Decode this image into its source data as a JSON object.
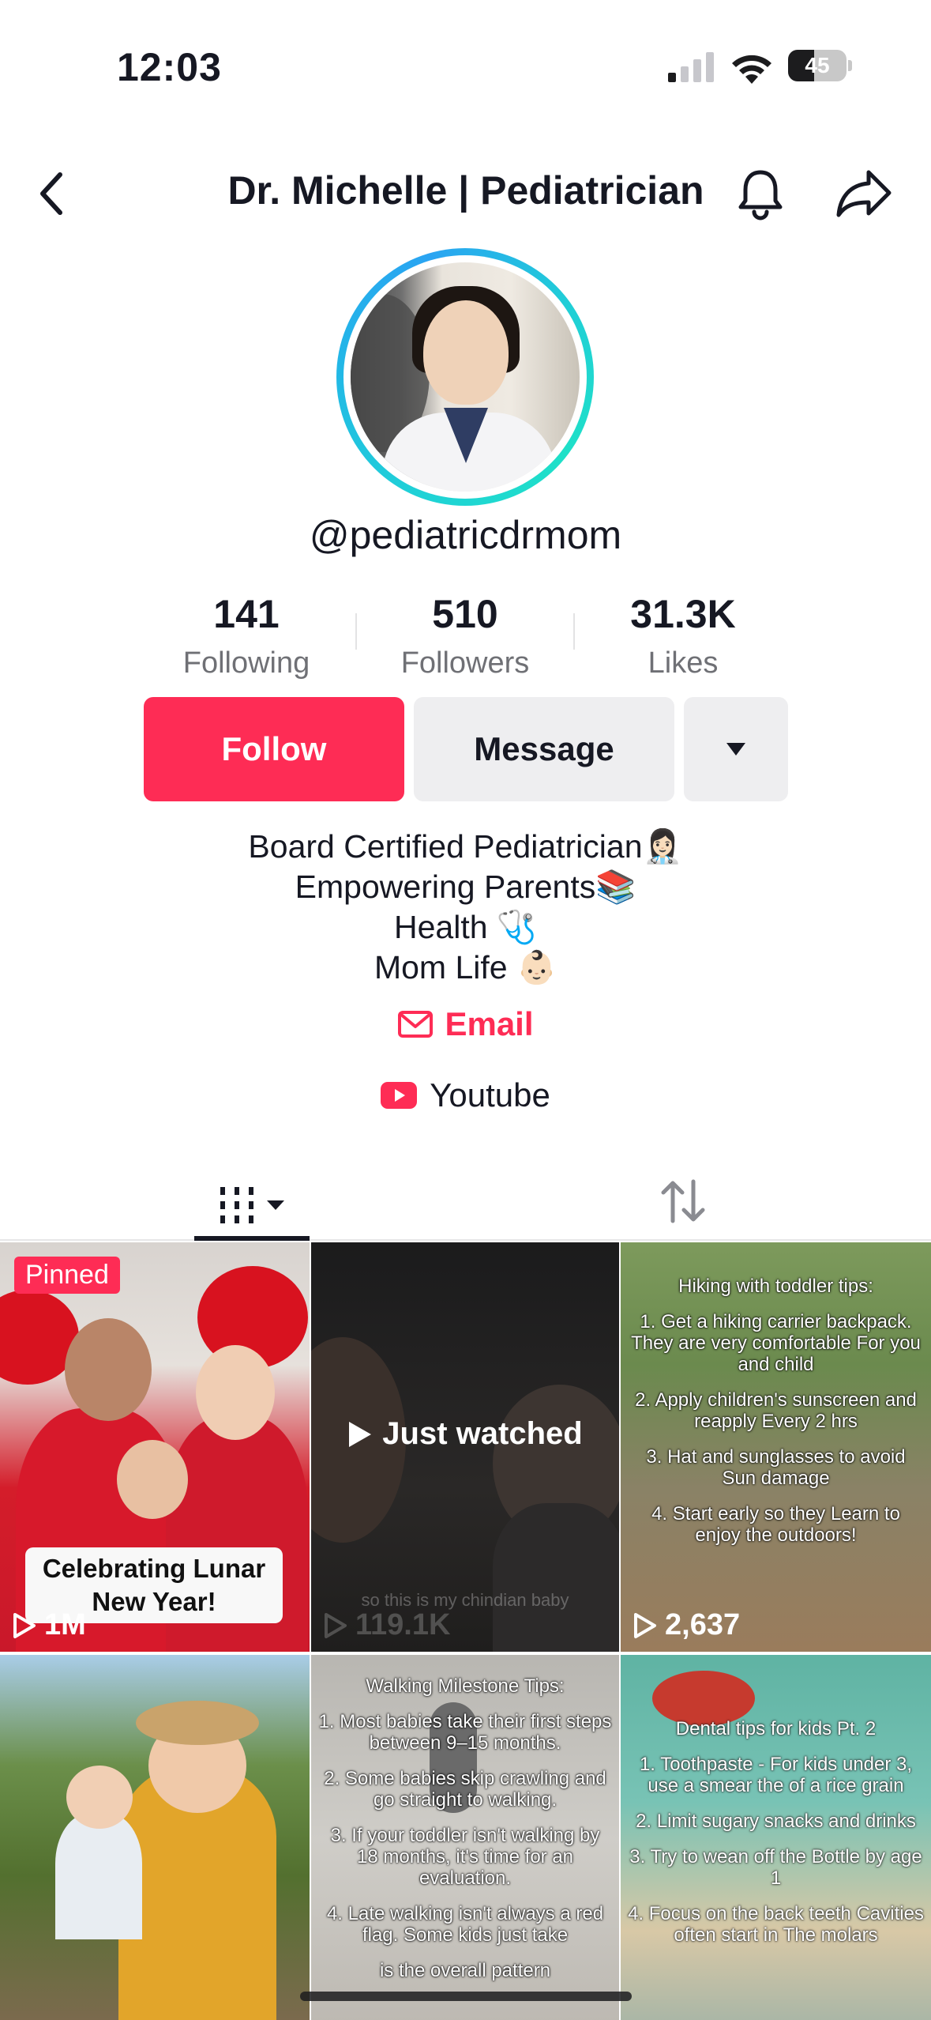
{
  "status_bar": {
    "time": "12:03",
    "battery_level": "45",
    "battery_fraction": 0.45
  },
  "header": {
    "title": "Dr. Michelle | Pediatrician",
    "icons": [
      "back-chevron-icon",
      "bell-icon",
      "share-arrow-icon"
    ]
  },
  "profile": {
    "username": "@pediatricdrmom",
    "avatar_ring_color": "#1fd2d6",
    "stats": [
      {
        "value": "141",
        "label": "Following"
      },
      {
        "value": "510",
        "label": "Followers"
      },
      {
        "value": "31.3K",
        "label": "Likes"
      }
    ],
    "follow_label": "Follow",
    "message_label": "Message",
    "follow_color": "#fe2c55"
  },
  "bio": {
    "lines": [
      {
        "text": "Board Certified Pediatrician",
        "emoji": "👩🏻‍⚕️"
      },
      {
        "text": "Empowering Parents",
        "emoji": "📚"
      },
      {
        "text": "Health ",
        "emoji": "🩺"
      },
      {
        "text": "Mom Life ",
        "emoji": "👶🏻"
      }
    ],
    "email_label": "Email",
    "youtube_label": "Youtube"
  },
  "tabs": {
    "active": "videos",
    "icons": [
      "videos-grid-icon",
      "reposts-icon"
    ]
  },
  "videos": [
    {
      "pinned_label": "Pinned",
      "caption": "Celebrating Lunar New Year!",
      "views": "1M"
    },
    {
      "status": "Just watched",
      "caption": "so this is my chindian baby",
      "views": "119.1K"
    },
    {
      "title": "Hiking with toddler tips:",
      "items": [
        "1. Get a hiking carrier backpack. They are very comfortable For you and child",
        "2. Apply children's sunscreen and reapply Every 2 hrs",
        "3. Hat and sunglasses to avoid Sun damage",
        "4. Start early so they Learn to enjoy the outdoors!"
      ],
      "views": "2,637"
    },
    {
      "caption": "",
      "views": ""
    },
    {
      "title": "Walking Milestone Tips:",
      "items": [
        "1. Most babies take their first steps between 9–15 months.",
        "2. Some babies skip crawling and go straight to walking.",
        "3. If your toddler isn't walking by 18 months, it's time for an evaluation.",
        "4. Late walking isn't always a red flag. Some kids just take",
        "is the overall pattern"
      ]
    },
    {
      "title": "Dental tips for kids Pt. 2",
      "items": [
        "1. Toothpaste - For kids under 3, use a smear the of a rice grain",
        "2. Limit sugary snacks and drinks",
        "3. Try to wean off the Bottle by age 1",
        "4. Focus on the back teeth Cavities often start in The molars"
      ]
    }
  ]
}
